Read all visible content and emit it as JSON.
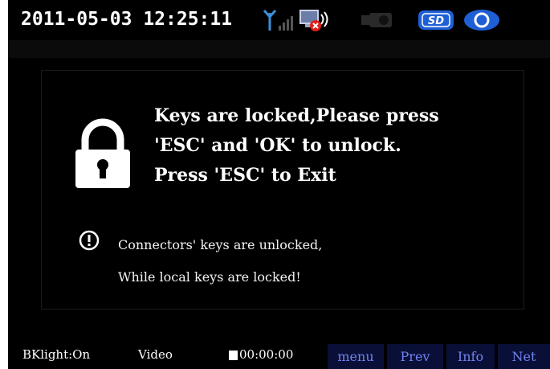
{
  "status_bar": {
    "datetime": "2011-05-03 12:25:11",
    "icons": [
      "signal-antenna-icon",
      "network-disconnected-icon",
      "camera-icon",
      "sd-card-icon",
      "record-icon"
    ],
    "sd_label": "SD"
  },
  "dialog": {
    "lock_lines": [
      "Keys are locked,Please press",
      "'ESC' and 'OK' to unlock.",
      "Press 'ESC' to Exit"
    ],
    "info_lines": [
      "Connectors' keys are unlocked,",
      "While local keys are locked!"
    ]
  },
  "bottom_bar": {
    "backlight": "BKlight:On",
    "mode": "Video",
    "timer": "00:00:00",
    "soft_keys": [
      "menu",
      "Prev",
      "Info",
      "Net"
    ]
  },
  "colors": {
    "background": "#000000",
    "text": "#ffffff",
    "soft_key_bg": "#0a0f38",
    "soft_key_text": "#6f84ee",
    "icon_blue": "#1f5fd6",
    "alert_red": "#e0201b"
  }
}
